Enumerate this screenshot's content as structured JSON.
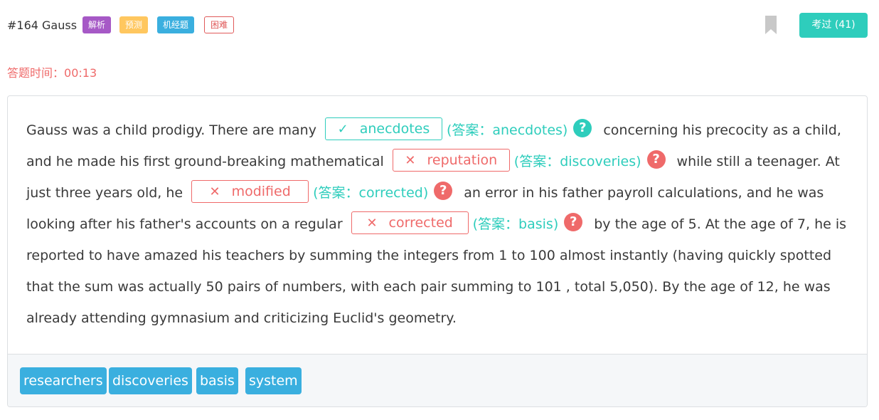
{
  "header": {
    "title": "#164 Gauss",
    "tags": [
      "解析",
      "预测",
      "机经题",
      "困难"
    ],
    "done_button": "考过 (41)",
    "bookmark_icon": "bookmark-icon"
  },
  "timer": {
    "label": "答题时间：",
    "value": "00:13"
  },
  "passage": {
    "seg0": "Gauss was a child prodigy. There are many",
    "seg1": "concerning his precocity as a child, and he made his first ground-breaking mathematical",
    "seg2": "while still a teenager. At just three years old, he",
    "seg3": "an error in his father payroll calculations, and he was looking after his father's accounts on a regular",
    "seg4": "by the age of 5. At the age of 7, he is reported to have amazed his teachers by summing the integers from 1 to 100 almost instantly (having quickly spotted that the sum was actually 50 pairs of numbers, with each pair summing to 101 , total 5,050). By the age of 12, he was already attending gymnasium and criticizing Euclid's geometry.",
    "blanks": [
      {
        "user": "anecdotes",
        "answer": "(答案：anecdotes)",
        "status": "correct",
        "mark": "✓"
      },
      {
        "user": "reputation",
        "answer": "(答案：discoveries)",
        "status": "wrong",
        "mark": "✕"
      },
      {
        "user": "modified",
        "answer": "(答案：corrected)",
        "status": "wrong",
        "mark": "✕"
      },
      {
        "user": "corrected",
        "answer": "(答案：basis)",
        "status": "wrong",
        "mark": "✕"
      }
    ],
    "help_glyph": "?"
  },
  "options": [
    "researchers",
    "discoveries",
    "basis",
    "system"
  ],
  "colors": {
    "accent_teal": "#2ecdbc",
    "error_red": "#ef6a6a",
    "tag_purple": "#a659c6",
    "tag_yellow": "#ffc75f",
    "tag_blue": "#3aafdf"
  }
}
